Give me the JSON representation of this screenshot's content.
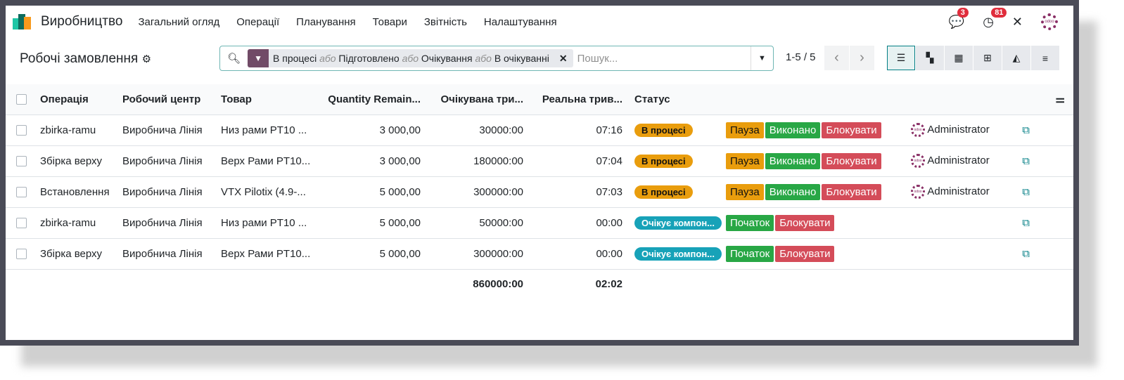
{
  "nav": {
    "brand": "Виробництво",
    "menu": [
      "Загальний огляд",
      "Операції",
      "Планування",
      "Товари",
      "Звітність",
      "Налаштування"
    ],
    "messages_count": "3",
    "activities_count": "81",
    "avatar_text": "odoo"
  },
  "page": {
    "title": "Робочі замовлення"
  },
  "search": {
    "facets": [
      "В процесі",
      "Підготовлено",
      "Очікування",
      "В очікуванні"
    ],
    "or": "або",
    "placeholder": "Пошук..."
  },
  "pager": {
    "value": "1-5 / 5"
  },
  "table": {
    "headers": [
      "Операція",
      "Робочий центр",
      "Товар",
      "Quantity Remain...",
      "Очікувана три...",
      "Реальна трив...",
      "Статус"
    ],
    "rows": [
      {
        "op": "zbirka-ramu",
        "wc": "Виробнича Лінія",
        "product": "Низ рами PT10 ...",
        "qty": "3 000,00",
        "expected": "30000:00",
        "real": "07:16",
        "status": "В процесі",
        "status_kind": "progress",
        "buttons": [
          "Пауза",
          "Виконано",
          "Блокувати"
        ],
        "user": "Administrator"
      },
      {
        "op": "Збірка верху",
        "wc": "Виробнича Лінія",
        "product": "Верх Рами PT10...",
        "qty": "3 000,00",
        "expected": "180000:00",
        "real": "07:04",
        "status": "В процесі",
        "status_kind": "progress",
        "buttons": [
          "Пауза",
          "Виконано",
          "Блокувати"
        ],
        "user": "Administrator"
      },
      {
        "op": "Встановлення",
        "wc": "Виробнича Лінія",
        "product": "VTX Pilotix (4.9-...",
        "qty": "5 000,00",
        "expected": "300000:00",
        "real": "07:03",
        "status": "В процесі",
        "status_kind": "progress",
        "buttons": [
          "Пауза",
          "Виконано",
          "Блокувати"
        ],
        "user": "Administrator"
      },
      {
        "op": "zbirka-ramu",
        "wc": "Виробнича Лінія",
        "product": "Низ рами PT10 ...",
        "qty": "5 000,00",
        "expected": "50000:00",
        "real": "00:00",
        "status": "Очікує компон...",
        "status_kind": "waiting",
        "buttons": [
          "Початок",
          "Блокувати"
        ],
        "user": ""
      },
      {
        "op": "Збірка верху",
        "wc": "Виробнича Лінія",
        "product": "Верх Рами PT10...",
        "qty": "5 000,00",
        "expected": "300000:00",
        "real": "00:00",
        "status": "Очікує компон...",
        "status_kind": "waiting",
        "buttons": [
          "Початок",
          "Блокувати"
        ],
        "user": ""
      }
    ],
    "totals": {
      "expected": "860000:00",
      "real": "02:02"
    }
  },
  "colors": {
    "progress": "#e99d0d",
    "waiting": "#17a2b8",
    "accent": "#017e84",
    "brand": "#714b67"
  }
}
